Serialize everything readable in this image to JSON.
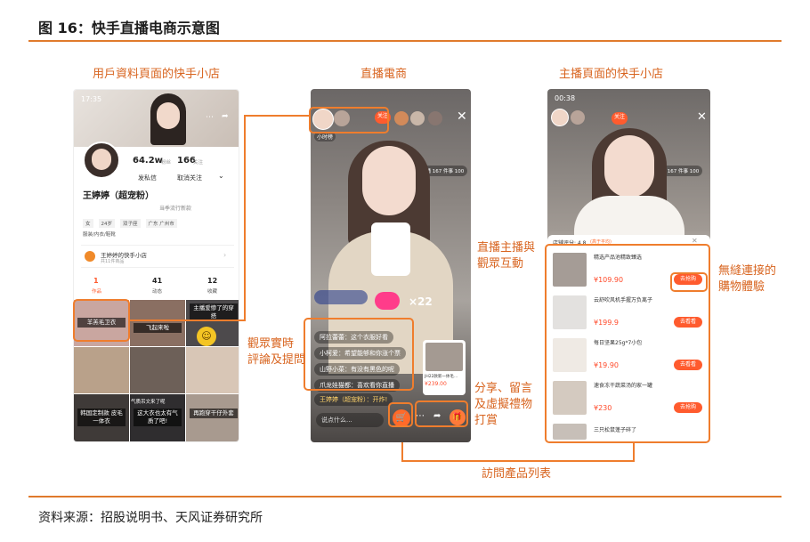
{
  "figure": {
    "title": "图 16：快手直播电商示意图",
    "source": "资料来源：招股说明书、天风证券研究所"
  },
  "captions": {
    "left": "用戶資料頁面的快手小店",
    "middle": "直播電商",
    "right": "主播頁面的快手小店"
  },
  "annotations": {
    "interaction": [
      "直播主播與",
      "觀眾互動"
    ],
    "comments": [
      "觀眾實時",
      "評論及提問"
    ],
    "share": [
      "分享、留言",
      "及虛擬禮物",
      "打賞"
    ],
    "seamless": [
      "無縫連接的",
      "購物體驗"
    ],
    "visit_list": "訪問產品列表"
  },
  "left_phone": {
    "time": "17:35",
    "followers": "64.2w",
    "followers_unit": "粉丝",
    "following": "166",
    "following_unit": "关注",
    "btn_message": "发私信",
    "btn_unfollow": "取消关注",
    "name": "王婷婷（超宠粉）",
    "bio": "当季流行新款",
    "tags": [
      "女",
      "24岁",
      "双子座",
      "广东 广州市"
    ],
    "tag_line": "服装/内衣/鞋靴",
    "shop_name": "王婷婷的快手小店",
    "shop_sub": "共11件商品",
    "stats": [
      {
        "num": "1",
        "label": "作品"
      },
      {
        "num": "41",
        "label": "动态"
      },
      {
        "num": "12",
        "label": "收藏"
      }
    ],
    "grid": [
      {
        "label": "羊羔毛卫衣",
        "color": "#c9a6a0"
      },
      {
        "label": "飞起来啦",
        "color": "#8a6f62"
      },
      {
        "label": "主播爱惨了的穿搭",
        "color": "#4d4a4c"
      },
      {
        "label": "",
        "color": "#b9a18a"
      },
      {
        "label": "",
        "color": "#6d6058"
      },
      {
        "label": "",
        "color": "#d8c6b6"
      },
      {
        "label": "韩国定制款 皮毛一体衣",
        "color": "#3f3a38"
      },
      {
        "label": "这大衣也太有气质了吧!",
        "color": "#2f2d2f"
      },
      {
        "label": "再跑穿干仔外套",
        "color": "#a89a8f"
      },
      {
        "label": "",
        "color": "#c4b8ad"
      },
      {
        "label": "气质吊文来了呢",
        "color": "#7e6f66"
      },
      {
        "label": "",
        "color": "#b3a79e"
      }
    ]
  },
  "middle_phone": {
    "tag_small": "小时榜",
    "follow_btn": "关注",
    "live_badge": "主播 167 件事 100",
    "like_count": "×22",
    "comments": [
      "阿拉蕾蕾：这个衣服好看",
      "小柯爱：希望能够和你涨个票",
      "山野小菜：有没有黑色的呢",
      "爪龙娃猫都：喜欢看你直播"
    ],
    "host_line": "王婷婷（超宠粉）：开炸!",
    "input_hint": "说点什么...",
    "product_price": "¥239.00",
    "product_name": "JH22款新一体毛..."
  },
  "right_phone": {
    "time": "00:38",
    "follow_btn": "关注",
    "live_badge": "主播 167 件事 100",
    "shop_header": "店铺评分: 4.8",
    "shop_header_sub": "(高于平均)",
    "products": [
      {
        "name": "精选产品池精致臻选",
        "price": "¥109.90",
        "btn": "去抢购"
      },
      {
        "name": "云舒吹风机手握万负离子",
        "price": "¥199.9",
        "btn": "去看看"
      },
      {
        "name": "每日坚果25g*7小包",
        "price": "¥19.90",
        "btn": "去看看"
      },
      {
        "name": "速食冻干蔬菜汤的家一罐",
        "price": "¥230",
        "btn": "去抢购"
      },
      {
        "name": "三只松鼠蓬子碎了",
        "price": "",
        "btn": ""
      }
    ]
  },
  "colors": {
    "accent": "#e07a2c",
    "annotation": "#d8641f",
    "box": "#ef7d2d"
  }
}
